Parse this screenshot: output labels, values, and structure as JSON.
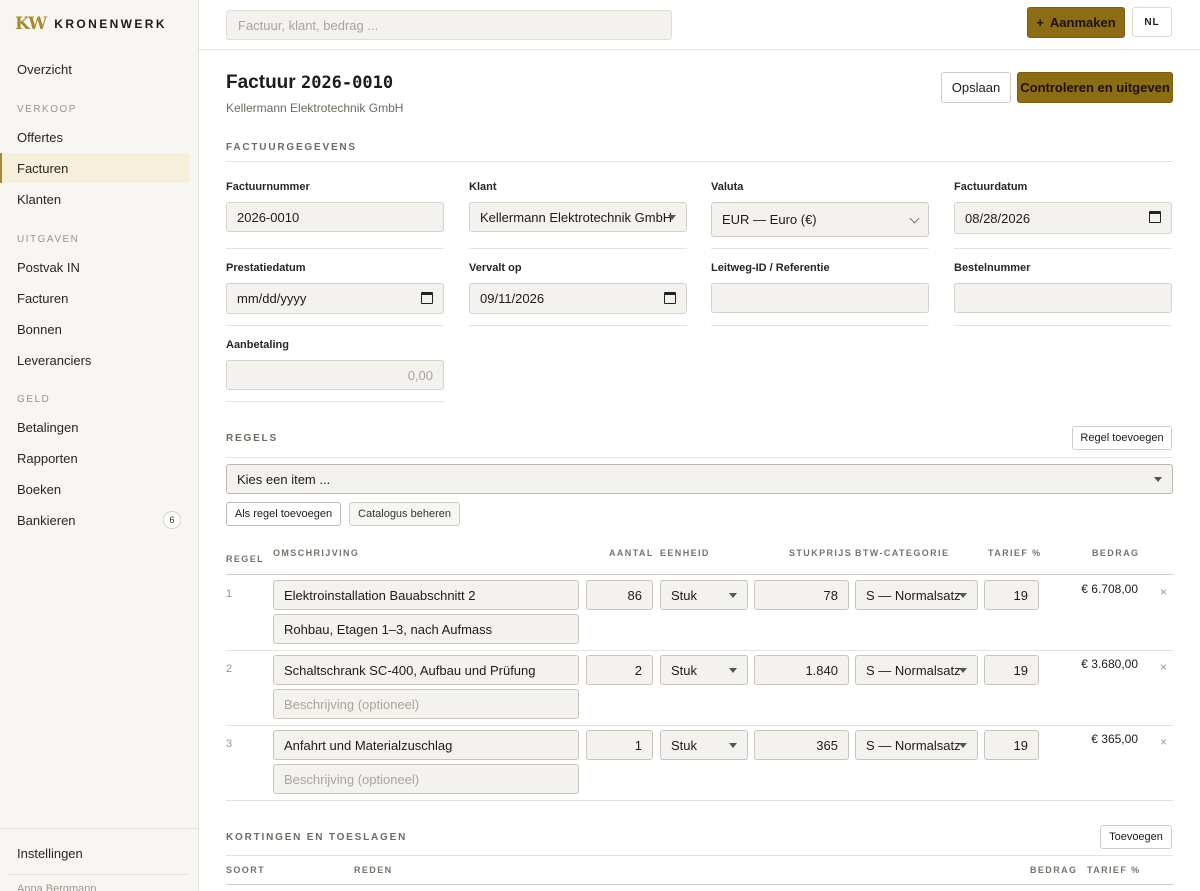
{
  "brand": {
    "mark": "KW",
    "name": "KRONENWERK"
  },
  "sidebar": {
    "top_item": "Overzicht",
    "sections": [
      {
        "title": "VERKOOP",
        "items": [
          "Offertes",
          "Facturen",
          "Klanten"
        ]
      },
      {
        "title": "UITGAVEN",
        "items": [
          "Postvak IN",
          "Facturen",
          "Bonnen",
          "Leveranciers"
        ]
      },
      {
        "title": "GELD",
        "items": [
          "Betalingen",
          "Rapporten",
          "Boeken",
          "Bankieren"
        ]
      }
    ],
    "active_item": "Facturen",
    "bankieren_badge": "6",
    "settings": "Instellingen",
    "user": "Anna Bergmann"
  },
  "topbar": {
    "search_placeholder": "Factuur, klant, bedrag ...",
    "create_icon": "+",
    "create_label": "Aanmaken",
    "lang": "NL"
  },
  "header": {
    "title_prefix": "Factuur",
    "invoice_number": "2026-0010",
    "customer": "Kellermann Elektrotechnik GmbH",
    "save_label": "Opslaan",
    "issue_label": "Controleren en uitgeven"
  },
  "details": {
    "section_title": "FACTUURGEGEVENS",
    "fields": {
      "invoice_number": {
        "label": "Factuurnummer",
        "value": "2026-0010"
      },
      "customer": {
        "label": "Klant",
        "value": "Kellermann Elektrotechnik GmbH"
      },
      "currency": {
        "label": "Valuta",
        "value": "EUR — Euro (€)"
      },
      "invoice_date": {
        "label": "Factuurdatum",
        "value": "08/28/2026"
      },
      "service_date": {
        "label": "Prestatiedatum",
        "value": "mm/dd/yyyy"
      },
      "due_date": {
        "label": "Vervalt op",
        "value": "09/11/2026"
      },
      "leitweg": {
        "label": "Leitweg-ID / Referentie",
        "value": ""
      },
      "order_number": {
        "label": "Bestelnummer",
        "value": ""
      },
      "down_payment": {
        "label": "Aanbetaling",
        "placeholder": "0,00"
      }
    }
  },
  "lines": {
    "section_title": "REGELS",
    "add_line_label": "Regel toevoegen",
    "item_picker_placeholder": "Kies een item ...",
    "add_as_line_label": "Als regel toevoegen",
    "manage_catalog_label": "Catalogus beheren",
    "columns": [
      "REGEL",
      "OMSCHRIJVING",
      "AANTAL",
      "EENHEID",
      "STUKPRIJS",
      "BTW-CATEGORIE",
      "TARIEF %",
      "BEDRAG"
    ],
    "description_placeholder": "Beschrijving (optioneel)",
    "delete_icon": "×",
    "rows": [
      {
        "num": "1",
        "title": "Elektroinstallation Bauabschnitt 2",
        "description": "Rohbau, Etagen 1–3, nach Aufmass",
        "qty": "86",
        "unit": "Stuk",
        "price": "78",
        "vat": "S — Normalsatz",
        "rate": "19",
        "amount": "€ 6.708,00"
      },
      {
        "num": "2",
        "title": "Schaltschrank SC-400, Aufbau und Prüfung",
        "description": "",
        "qty": "2",
        "unit": "Stuk",
        "price": "1.840",
        "vat": "S — Normalsatz",
        "rate": "19",
        "amount": "€ 3.680,00"
      },
      {
        "num": "3",
        "title": "Anfahrt und Materialzuschlag",
        "description": "",
        "qty": "1",
        "unit": "Stuk",
        "price": "365",
        "vat": "S — Normalsatz",
        "rate": "19",
        "amount": "€ 365,00"
      }
    ]
  },
  "discounts": {
    "section_title": "KORTINGEN EN TOESLAGEN",
    "add_label": "Toevoegen",
    "columns": [
      "SOORT",
      "REDEN",
      "BEDRAG",
      "TARIEF %"
    ]
  }
}
